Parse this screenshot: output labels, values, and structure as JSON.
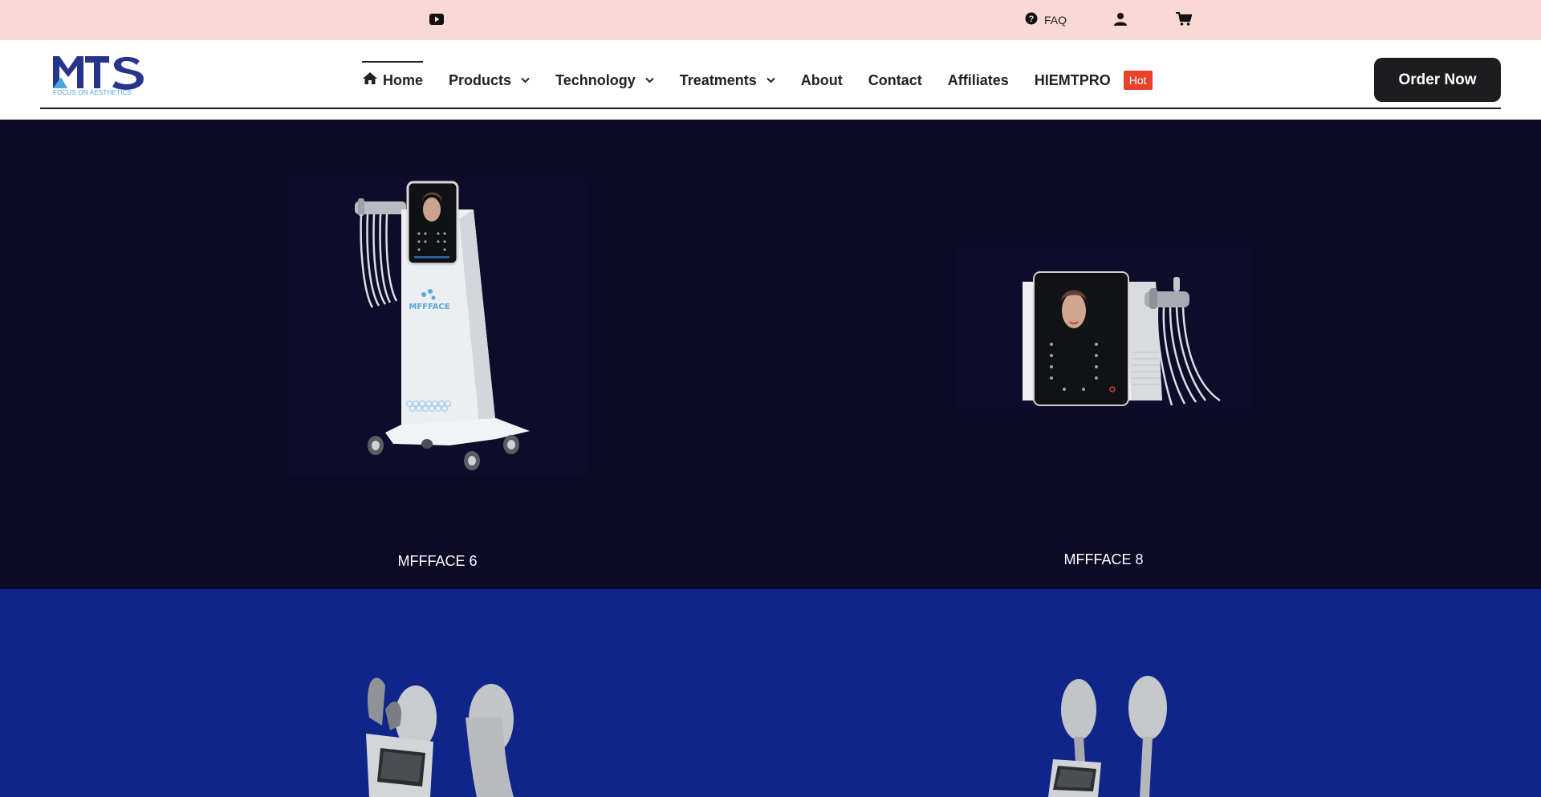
{
  "topbar": {
    "faq_label": "FAQ",
    "icons": [
      "youtube-icon",
      "question-circle-icon",
      "user-icon",
      "cart-icon"
    ]
  },
  "logo": {
    "text": "MTS",
    "tagline": "FOCUS ON AESTHETICS"
  },
  "nav": {
    "items": [
      {
        "label": "Home",
        "icon": "home-icon",
        "active": true
      },
      {
        "label": "Products",
        "dropdown": true
      },
      {
        "label": "Technology",
        "dropdown": true
      },
      {
        "label": "Treatments",
        "dropdown": true
      },
      {
        "label": "About"
      },
      {
        "label": "Contact"
      },
      {
        "label": "Affiliates"
      },
      {
        "label": "HIEMTPRO",
        "badge": "Hot"
      }
    ],
    "order_button": "Order Now"
  },
  "products": [
    {
      "name": "MFFFACE 6"
    },
    {
      "name": "MFFFACE 8"
    }
  ],
  "colors": {
    "topbar_bg": "#f9d9d3",
    "dark_section_bg": "#0c0a25",
    "blue_section_bg": "#0f258a",
    "hot_badge": "#e8412c",
    "logo_navy": "#27348b",
    "logo_blue": "#4aa6df"
  }
}
